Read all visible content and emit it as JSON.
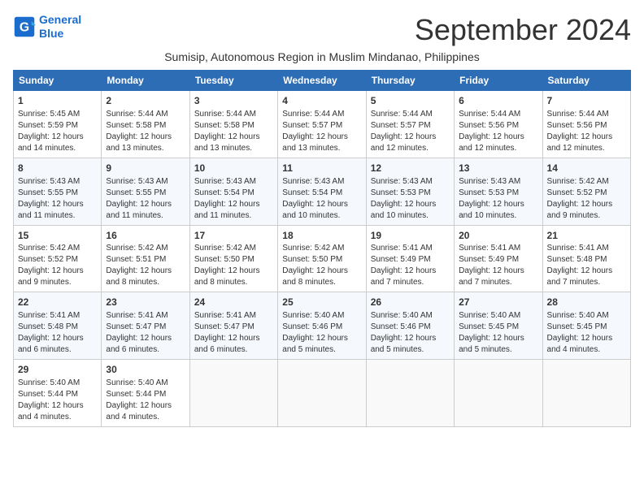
{
  "logo": {
    "line1": "General",
    "line2": "Blue"
  },
  "title": "September 2024",
  "subtitle": "Sumisip, Autonomous Region in Muslim Mindanao, Philippines",
  "days_header": [
    "Sunday",
    "Monday",
    "Tuesday",
    "Wednesday",
    "Thursday",
    "Friday",
    "Saturday"
  ],
  "weeks": [
    [
      {
        "day": "1",
        "sunrise": "5:45 AM",
        "sunset": "5:59 PM",
        "daylight": "12 hours and 14 minutes"
      },
      {
        "day": "2",
        "sunrise": "5:44 AM",
        "sunset": "5:58 PM",
        "daylight": "12 hours and 13 minutes"
      },
      {
        "day": "3",
        "sunrise": "5:44 AM",
        "sunset": "5:58 PM",
        "daylight": "12 hours and 13 minutes"
      },
      {
        "day": "4",
        "sunrise": "5:44 AM",
        "sunset": "5:57 PM",
        "daylight": "12 hours and 13 minutes"
      },
      {
        "day": "5",
        "sunrise": "5:44 AM",
        "sunset": "5:57 PM",
        "daylight": "12 hours and 12 minutes"
      },
      {
        "day": "6",
        "sunrise": "5:44 AM",
        "sunset": "5:56 PM",
        "daylight": "12 hours and 12 minutes"
      },
      {
        "day": "7",
        "sunrise": "5:44 AM",
        "sunset": "5:56 PM",
        "daylight": "12 hours and 12 minutes"
      }
    ],
    [
      {
        "day": "8",
        "sunrise": "5:43 AM",
        "sunset": "5:55 PM",
        "daylight": "12 hours and 11 minutes"
      },
      {
        "day": "9",
        "sunrise": "5:43 AM",
        "sunset": "5:55 PM",
        "daylight": "12 hours and 11 minutes"
      },
      {
        "day": "10",
        "sunrise": "5:43 AM",
        "sunset": "5:54 PM",
        "daylight": "12 hours and 11 minutes"
      },
      {
        "day": "11",
        "sunrise": "5:43 AM",
        "sunset": "5:54 PM",
        "daylight": "12 hours and 10 minutes"
      },
      {
        "day": "12",
        "sunrise": "5:43 AM",
        "sunset": "5:53 PM",
        "daylight": "12 hours and 10 minutes"
      },
      {
        "day": "13",
        "sunrise": "5:43 AM",
        "sunset": "5:53 PM",
        "daylight": "12 hours and 10 minutes"
      },
      {
        "day": "14",
        "sunrise": "5:42 AM",
        "sunset": "5:52 PM",
        "daylight": "12 hours and 9 minutes"
      }
    ],
    [
      {
        "day": "15",
        "sunrise": "5:42 AM",
        "sunset": "5:52 PM",
        "daylight": "12 hours and 9 minutes"
      },
      {
        "day": "16",
        "sunrise": "5:42 AM",
        "sunset": "5:51 PM",
        "daylight": "12 hours and 8 minutes"
      },
      {
        "day": "17",
        "sunrise": "5:42 AM",
        "sunset": "5:50 PM",
        "daylight": "12 hours and 8 minutes"
      },
      {
        "day": "18",
        "sunrise": "5:42 AM",
        "sunset": "5:50 PM",
        "daylight": "12 hours and 8 minutes"
      },
      {
        "day": "19",
        "sunrise": "5:41 AM",
        "sunset": "5:49 PM",
        "daylight": "12 hours and 7 minutes"
      },
      {
        "day": "20",
        "sunrise": "5:41 AM",
        "sunset": "5:49 PM",
        "daylight": "12 hours and 7 minutes"
      },
      {
        "day": "21",
        "sunrise": "5:41 AM",
        "sunset": "5:48 PM",
        "daylight": "12 hours and 7 minutes"
      }
    ],
    [
      {
        "day": "22",
        "sunrise": "5:41 AM",
        "sunset": "5:48 PM",
        "daylight": "12 hours and 6 minutes"
      },
      {
        "day": "23",
        "sunrise": "5:41 AM",
        "sunset": "5:47 PM",
        "daylight": "12 hours and 6 minutes"
      },
      {
        "day": "24",
        "sunrise": "5:41 AM",
        "sunset": "5:47 PM",
        "daylight": "12 hours and 6 minutes"
      },
      {
        "day": "25",
        "sunrise": "5:40 AM",
        "sunset": "5:46 PM",
        "daylight": "12 hours and 5 minutes"
      },
      {
        "day": "26",
        "sunrise": "5:40 AM",
        "sunset": "5:46 PM",
        "daylight": "12 hours and 5 minutes"
      },
      {
        "day": "27",
        "sunrise": "5:40 AM",
        "sunset": "5:45 PM",
        "daylight": "12 hours and 5 minutes"
      },
      {
        "day": "28",
        "sunrise": "5:40 AM",
        "sunset": "5:45 PM",
        "daylight": "12 hours and 4 minutes"
      }
    ],
    [
      {
        "day": "29",
        "sunrise": "5:40 AM",
        "sunset": "5:44 PM",
        "daylight": "12 hours and 4 minutes"
      },
      {
        "day": "30",
        "sunrise": "5:40 AM",
        "sunset": "5:44 PM",
        "daylight": "12 hours and 4 minutes"
      },
      null,
      null,
      null,
      null,
      null
    ]
  ]
}
